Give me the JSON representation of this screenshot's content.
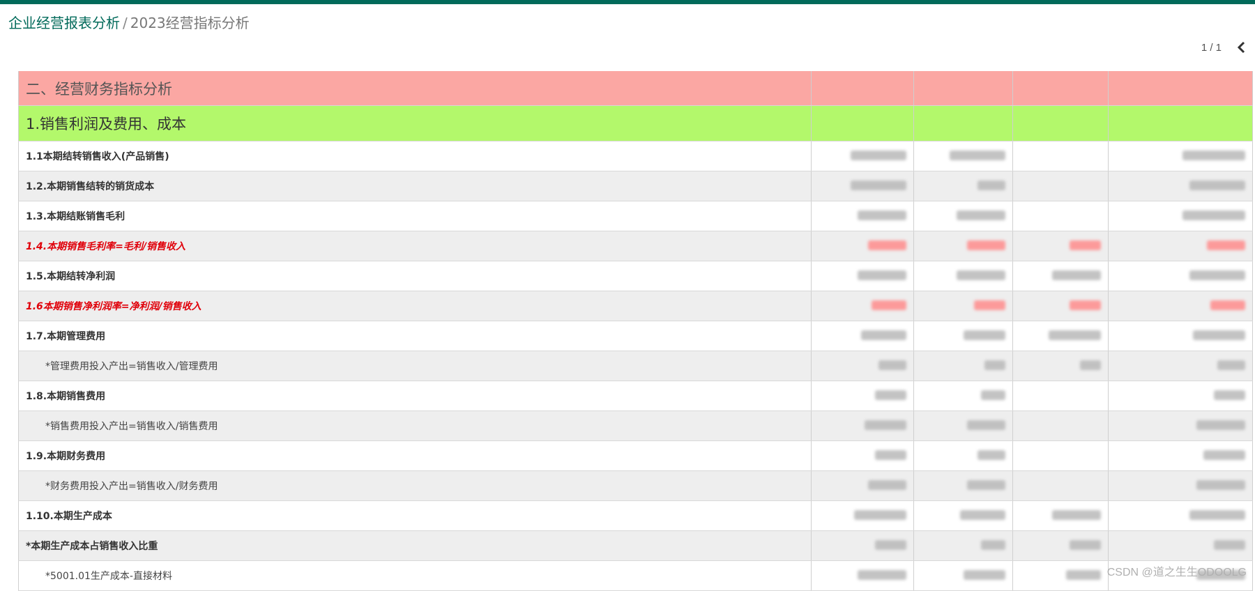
{
  "breadcrumb": {
    "root": "企业经营报表分析",
    "separator": "/",
    "current": "2023经营指标分析"
  },
  "pager": {
    "value": "1 / 1",
    "prev_icon": "chevron-left-icon"
  },
  "colors": {
    "topbar": "#016a5a",
    "section_bg": "#fba7a3",
    "subsection_bg": "#b3f86b",
    "highlight_text": "#e0000a",
    "row_alt_bg": "#eeeeee"
  },
  "report": {
    "section_title": "二、经营财务指标分析",
    "subsection_title": "1.销售利润及费用、成本",
    "rows": [
      {
        "label": "1.1本期结转销售收入(产品销售)",
        "style": "bold",
        "bg": "white"
      },
      {
        "label": "1.2.本期销售结转的销货成本",
        "style": "bold",
        "bg": "gray"
      },
      {
        "label": "1.3.本期结账销售毛利",
        "style": "bold",
        "bg": "white"
      },
      {
        "label": "1.4.本期销售毛利率=毛利/销售收入",
        "style": "red",
        "bg": "gray"
      },
      {
        "label": "1.5.本期结转净利润",
        "style": "bold",
        "bg": "white"
      },
      {
        "label": "1.6本期销售净利润率=净利润/销售收入",
        "style": "red",
        "bg": "gray"
      },
      {
        "label": "1.7.本期管理费用",
        "style": "bold",
        "bg": "white"
      },
      {
        "label": "*管理费用投入产出=销售收入/管理费用",
        "style": "indent",
        "bg": "gray"
      },
      {
        "label": "1.8.本期销售费用",
        "style": "bold",
        "bg": "white"
      },
      {
        "label": "*销售费用投入产出=销售收入/销售费用",
        "style": "indent",
        "bg": "gray"
      },
      {
        "label": "1.9.本期财务费用",
        "style": "bold",
        "bg": "white"
      },
      {
        "label": "*财务费用投入产出=销售收入/财务费用",
        "style": "indent",
        "bg": "gray"
      },
      {
        "label": "1.10.本期生产成本",
        "style": "bold",
        "bg": "white"
      },
      {
        "label": "*本期生产成本占销售收入比重",
        "style": "bold",
        "bg": "gray"
      },
      {
        "label": "*5001.01生产成本-直接材料",
        "style": "indent",
        "bg": "white"
      }
    ]
  },
  "watermark": "CSDN @道之生生ODOOLG"
}
